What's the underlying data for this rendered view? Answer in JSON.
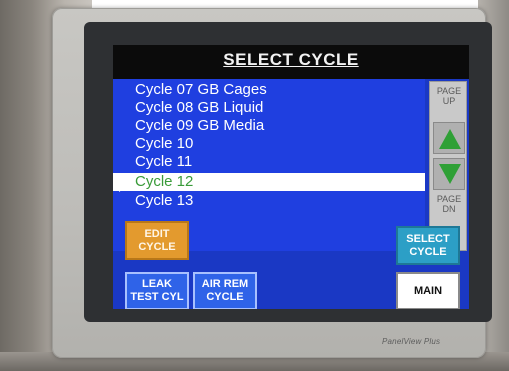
{
  "screen": {
    "title": "SELECT CYCLE",
    "cycles": [
      "Cycle 07 GB Cages",
      "Cycle 08 GB Liquid",
      "Cycle 09 GB Media",
      "Cycle 10",
      "Cycle 11",
      "Cycle 12",
      "Cycle 13"
    ],
    "selected_cycle": "Cycle 12",
    "page_up_label": "PAGE\nUP",
    "page_down_label": "PAGE\nDN",
    "buttons": {
      "edit_cycle": "EDIT\nCYCLE",
      "select_cycle": "SELECT\nCYCLE",
      "leak_test": "LEAK\nTEST CYL",
      "air_rem": "AIR REM\nCYCLE",
      "main": "MAIN"
    }
  },
  "device": {
    "brand": "PanelView Plus"
  },
  "colors": {
    "screen_bg": "#1a38c4",
    "accent_green": "#2fa036",
    "edit_orange": "#e39a2e",
    "select_teal": "#2c9fc6"
  }
}
